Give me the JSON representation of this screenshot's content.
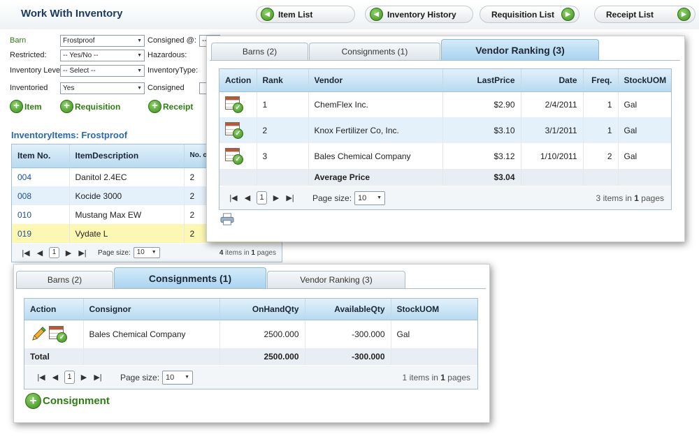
{
  "header": {
    "title": "Work With Inventory",
    "nav": [
      {
        "label": "Item List",
        "icon": "arrow-left-icon"
      },
      {
        "label": "Inventory History",
        "icon": "arrow-left-icon"
      },
      {
        "label": "Requisition List",
        "icon": "arrow-right-icon"
      },
      {
        "label": "Receipt List",
        "icon": "arrow-right-icon"
      }
    ]
  },
  "filters": {
    "barn_label": "Barn",
    "barn_value": "Frostproof",
    "consigned_at_label": "Consigned @:",
    "consigned_at_value": "--",
    "restricted_label": "Restricted:",
    "restricted_value": "-- Yes/No --",
    "hazardous_label": "Hazardous:",
    "inventory_level_label": "Inventory Level:",
    "inventory_level_value": "-- Select --",
    "inventory_type_label": "InventoryType:",
    "inventoried_label": "Inventoried",
    "inventoried_value": "Yes",
    "consigned_label": "Consigned"
  },
  "actions": {
    "item": "Item",
    "requisition": "Requisition",
    "receipt": "Receipt"
  },
  "inventory": {
    "title": "InventoryItems: Frostproof",
    "columns": [
      "Item No.",
      "ItemDescription",
      "No. of Barn(s)"
    ],
    "rows": [
      {
        "item_no": "004",
        "desc": "Danitol 2.4EC",
        "barns": "2"
      },
      {
        "item_no": "008",
        "desc": "Kocide 3000",
        "barns": "2"
      },
      {
        "item_no": "010",
        "desc": "Mustang Max EW",
        "barns": "2"
      },
      {
        "item_no": "019",
        "desc": "Vydate L",
        "barns": "2"
      }
    ],
    "pager": {
      "page": "1",
      "page_size_label": "Page size:",
      "page_size": "10",
      "items": "4",
      "pages": "1"
    }
  },
  "vendor_popup": {
    "tabs": [
      "Barns (2)",
      "Consignments (1)",
      "Vendor Ranking (3)"
    ],
    "active_tab": 2,
    "columns": [
      "Action",
      "Rank",
      "Vendor",
      "LastPrice",
      "Date",
      "Freq.",
      "StockUOM"
    ],
    "rows": [
      {
        "rank": "1",
        "vendor": "ChemFlex Inc.",
        "price": "$2.90",
        "date": "2/4/2011",
        "freq": "1",
        "uom": "Gal"
      },
      {
        "rank": "2",
        "vendor": "Knox Fertilizer Co, Inc.",
        "price": "$3.10",
        "date": "3/1/2011",
        "freq": "1",
        "uom": "Gal"
      },
      {
        "rank": "3",
        "vendor": "Bales Chemical Company",
        "price": "$3.12",
        "date": "1/10/2011",
        "freq": "2",
        "uom": "Gal"
      }
    ],
    "footer": {
      "label": "Average Price",
      "value": "$3.04"
    },
    "pager": {
      "page": "1",
      "page_size_label": "Page size:",
      "page_size": "10",
      "items": "3",
      "pages": "1"
    }
  },
  "consign_popup": {
    "tabs": [
      "Barns (2)",
      "Consignments (1)",
      "Vendor Ranking (3)"
    ],
    "active_tab": 1,
    "columns": [
      "Action",
      "Consignor",
      "OnHandQty",
      "AvailableQty",
      "StockUOM"
    ],
    "rows": [
      {
        "consignor": "Bales Chemical Company",
        "onhand": "2500.000",
        "available": "-300.000",
        "uom": "Gal"
      }
    ],
    "footer": {
      "label": "Total",
      "onhand": "2500.000",
      "available": "-300.000"
    },
    "pager": {
      "page": "1",
      "page_size_label": "Page size:",
      "page_size": "10",
      "items": "1",
      "pages": "1"
    },
    "add_label": "Consignment"
  },
  "pager_words": {
    "items_in": "items in",
    "pages": "pages"
  },
  "colors": {
    "accent_green": "#2e7d12",
    "header_blue": "#b8daf0",
    "title_blue": "#2a69ad",
    "selected_row": "#fdf7b4"
  }
}
